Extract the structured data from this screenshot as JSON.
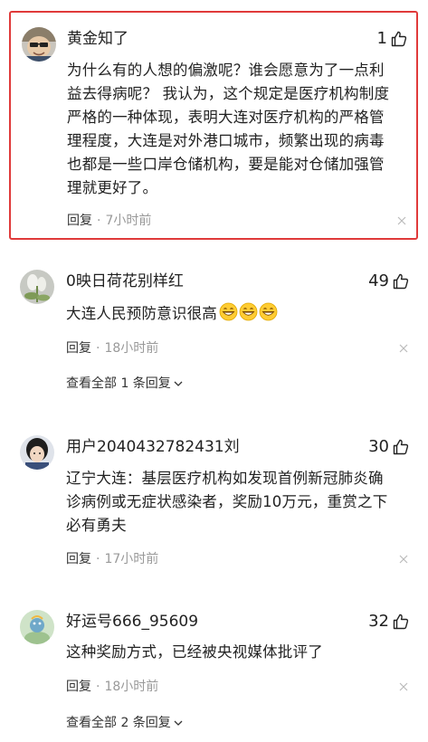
{
  "comments": [
    {
      "username": "黄金知了",
      "likes": "1",
      "lines": [
        "为什么有的人想的偏激呢？谁会愿意为了一点利",
        "益去得病呢？ 我认为，这个规定是医疗机构制度",
        "严格的一种体现，表明大连对医疗机构的严格管",
        "理程度，大连是对外港口城市，频繁出现的病毒",
        "也都是一些口岸仓储机构，要是能对仓储加强管",
        "理就更好了。"
      ],
      "reply_label": "回复",
      "time": "7小时前",
      "highlighted": true
    },
    {
      "username": "0映日荷花别样红",
      "likes": "49",
      "lines": [
        "大连人民预防意识很高"
      ],
      "emoji": [
        "grin-emoji",
        "grin-emoji",
        "grin-emoji"
      ],
      "reply_label": "回复",
      "time": "18小时前",
      "view_all": "查看全部 1 条回复"
    },
    {
      "username": "用户2040432782431刘",
      "likes": "30",
      "lines": [
        "辽宁大连：基层医疗机构如发现首例新冠肺炎确",
        "诊病例或无症状感染者，奖励10万元，重赏之下",
        "必有勇夫"
      ],
      "reply_label": "回复",
      "time": "17小时前"
    },
    {
      "username": "好运号666_95609",
      "likes": "32",
      "lines": [
        "这种奖励方式，已经被央视媒体批评了"
      ],
      "reply_label": "回复",
      "time": "18小时前",
      "view_all": "查看全部 2 条回复"
    }
  ],
  "colors": {
    "highlight_border": "#e03a3a",
    "muted_text": "#999999",
    "text": "#222222"
  }
}
